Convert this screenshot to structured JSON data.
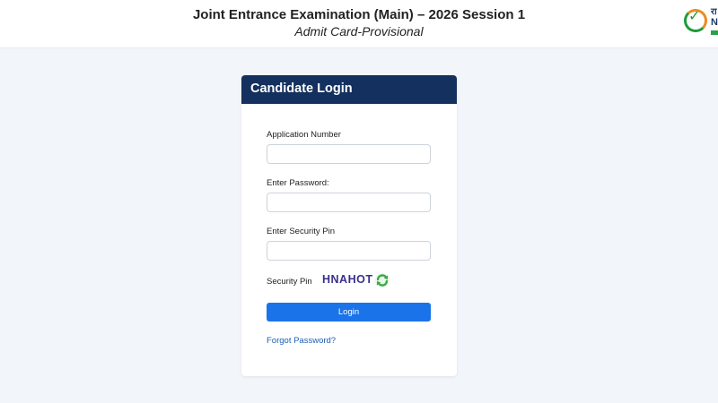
{
  "header": {
    "title": "Joint Entrance Examination (Main) – 2026 Session 1",
    "subtitle": "Admit Card-Provisional"
  },
  "logo": {
    "icon": "nta-logo-icon",
    "text_line1": "रा",
    "text_line2": "N"
  },
  "login_card": {
    "title": "Candidate Login",
    "application_number": {
      "label": "Application Number",
      "value": ""
    },
    "password": {
      "label": "Enter Password:",
      "value": ""
    },
    "security_pin_input": {
      "label": "Enter Security Pin",
      "value": ""
    },
    "security_pin": {
      "label": "Security Pin",
      "value": "HNAHOT",
      "refresh_icon": "refresh-icon"
    },
    "login_button": "Login",
    "forgot_password": "Forgot Password?"
  },
  "colors": {
    "card_header": "#14305e",
    "login_button": "#1a73e8",
    "link": "#1a5fb4",
    "pin_text": "#3a2f8e",
    "refresh": "#3aa845"
  }
}
